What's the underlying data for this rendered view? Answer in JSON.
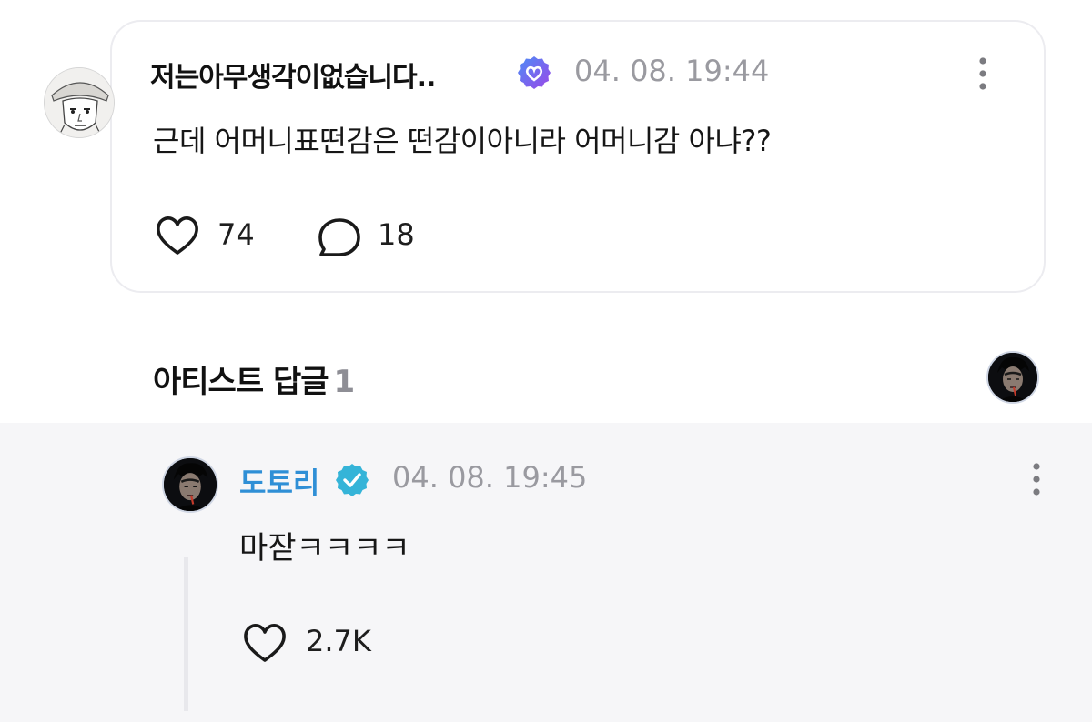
{
  "comment": {
    "username": "저는아무생각이없습니다..",
    "timestamp": "04. 08. 19:44",
    "text": "근데 어머니표떤감은 떤감이아니라 어머니감 아냐??",
    "like_count": "74",
    "reply_count": "18"
  },
  "artist_replies": {
    "title": "아티스트 답글",
    "count": "1"
  },
  "reply": {
    "username": "도토리",
    "timestamp": "04. 08. 19:45",
    "text": "마잗ㅋㅋㅋㅋ",
    "like_count": "2.7K"
  },
  "colors": {
    "artist_name": "#2f8fd6",
    "fan_badge": "#7d5cf0",
    "artist_badge": "#35b4d8",
    "reply_panel_bg": "#f6f6f8",
    "muted_text": "#9a9aa0"
  },
  "icons": {
    "fan_badge": "heart-check-badge-icon",
    "artist_badge": "verified-check-icon",
    "like": "heart-outline-icon",
    "reply": "speech-bubble-icon",
    "more": "vertical-ellipsis-icon"
  }
}
